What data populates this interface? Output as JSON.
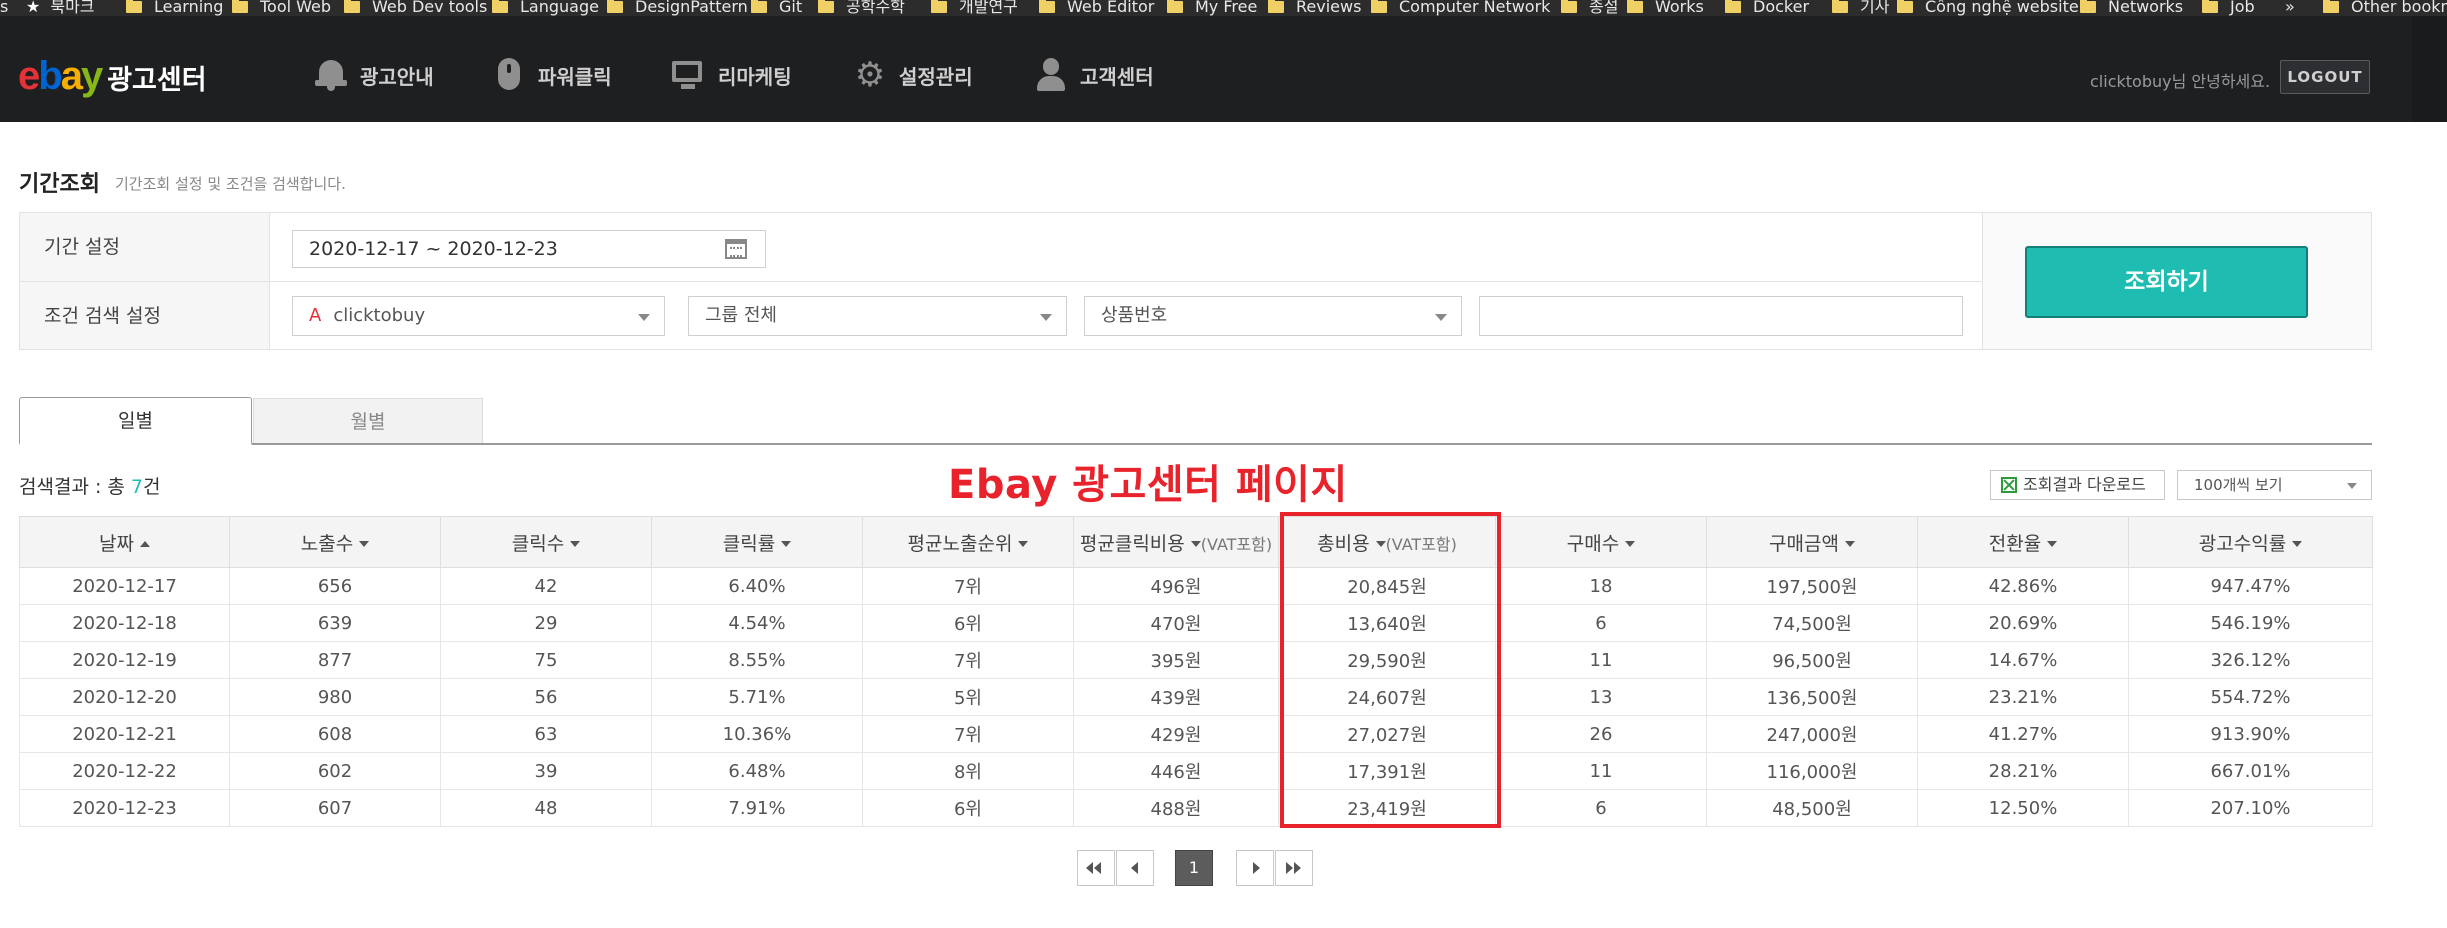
{
  "bookmarks": [
    {
      "label": "s",
      "icon": "none"
    },
    {
      "label": "북마크",
      "icon": "star-icon"
    },
    {
      "label": "Learning",
      "icon": "folder-icon"
    },
    {
      "label": "Tool Web",
      "icon": "folder-icon"
    },
    {
      "label": "Web Dev tools",
      "icon": "folder-icon"
    },
    {
      "label": "Language",
      "icon": "folder-icon"
    },
    {
      "label": "DesignPattern",
      "icon": "folder-icon"
    },
    {
      "label": "Git",
      "icon": "folder-icon"
    },
    {
      "label": "공학수학",
      "icon": "folder-icon"
    },
    {
      "label": "개발연구",
      "icon": "folder-icon"
    },
    {
      "label": "Web Editor",
      "icon": "folder-icon"
    },
    {
      "label": "My Free",
      "icon": "folder-icon"
    },
    {
      "label": "Reviews",
      "icon": "folder-icon"
    },
    {
      "label": "Computer Network",
      "icon": "folder-icon"
    },
    {
      "label": "종설",
      "icon": "folder-icon"
    },
    {
      "label": "Works",
      "icon": "folder-icon"
    },
    {
      "label": "Docker",
      "icon": "folder-icon"
    },
    {
      "label": "기사",
      "icon": "folder-icon"
    },
    {
      "label": "Công nghệ website",
      "icon": "folder-icon"
    },
    {
      "label": "Networks",
      "icon": "folder-icon"
    },
    {
      "label": "Job",
      "icon": "folder-icon"
    },
    {
      "label": "»",
      "icon": "none"
    },
    {
      "label": "Other bookmarks",
      "icon": "folder-icon"
    }
  ],
  "header": {
    "logo_text": "ebay",
    "logo_letters": [
      "e",
      "b",
      "a",
      "y"
    ],
    "title": "광고센터",
    "nav": [
      {
        "label": "광고안내",
        "icon": "bell-icon"
      },
      {
        "label": "파워클릭",
        "icon": "mouse-icon"
      },
      {
        "label": "리마케팅",
        "icon": "monitor-icon"
      },
      {
        "label": "설정관리",
        "icon": "gear-icon"
      },
      {
        "label": "고객센터",
        "icon": "user-icon"
      }
    ],
    "greeting": "clicktobuy님 안녕하세요.",
    "logout_label": "LOGOUT"
  },
  "search": {
    "title": "기간조회",
    "description": "기간조회 설정 및 조건을 검색합니다.",
    "period_label": "기간 설정",
    "date_range": "2020-12-17 ~ 2020-12-23",
    "condition_label": "조건 검색 설정",
    "account_prefix": "A",
    "account_select": "clicktobuy",
    "group_select": "그룹 전체",
    "product_select": "상품번호",
    "keyword_value": "",
    "query_button": "조회하기"
  },
  "tabs": [
    {
      "label": "일별",
      "active": true
    },
    {
      "label": "월별",
      "active": false
    }
  ],
  "results": {
    "count_prefix": "검색결과 : 총 ",
    "count": "7",
    "count_suffix": "건",
    "annotation": "Ebay 광고센터 페이지",
    "download_label": "조회결과 다운로드",
    "per_page": "100개씩 보기"
  },
  "table": {
    "columns": [
      {
        "label": "날짜",
        "sub": "",
        "sort": "up"
      },
      {
        "label": "노출수",
        "sub": "",
        "sort": "down"
      },
      {
        "label": "클릭수",
        "sub": "",
        "sort": "down"
      },
      {
        "label": "클릭률",
        "sub": "",
        "sort": "down"
      },
      {
        "label": "평균노출순위",
        "sub": "",
        "sort": "down"
      },
      {
        "label": "평균클릭비용",
        "sub": "(VAT포함)",
        "sort": "down"
      },
      {
        "label": "총비용",
        "sub": "(VAT포함)",
        "sort": "down"
      },
      {
        "label": "구매수",
        "sub": "",
        "sort": "down"
      },
      {
        "label": "구매금액",
        "sub": "",
        "sort": "down"
      },
      {
        "label": "전환율",
        "sub": "",
        "sort": "down"
      },
      {
        "label": "광고수익률",
        "sub": "",
        "sort": "down"
      }
    ],
    "rows": [
      [
        "2020-12-17",
        "656",
        "42",
        "6.40%",
        "7위",
        "496원",
        "20,845원",
        "18",
        "197,500원",
        "42.86%",
        "947.47%"
      ],
      [
        "2020-12-18",
        "639",
        "29",
        "4.54%",
        "6위",
        "470원",
        "13,640원",
        "6",
        "74,500원",
        "20.69%",
        "546.19%"
      ],
      [
        "2020-12-19",
        "877",
        "75",
        "8.55%",
        "7위",
        "395원",
        "29,590원",
        "11",
        "96,500원",
        "14.67%",
        "326.12%"
      ],
      [
        "2020-12-20",
        "980",
        "56",
        "5.71%",
        "5위",
        "439원",
        "24,607원",
        "13",
        "136,500원",
        "23.21%",
        "554.72%"
      ],
      [
        "2020-12-21",
        "608",
        "63",
        "10.36%",
        "7위",
        "429원",
        "27,027원",
        "26",
        "247,000원",
        "41.27%",
        "913.90%"
      ],
      [
        "2020-12-22",
        "602",
        "39",
        "6.48%",
        "8위",
        "446원",
        "17,391원",
        "11",
        "116,000원",
        "28.21%",
        "667.01%"
      ],
      [
        "2020-12-23",
        "607",
        "48",
        "7.91%",
        "6위",
        "488원",
        "23,419원",
        "6",
        "48,500원",
        "12.50%",
        "207.10%"
      ]
    ]
  },
  "pagination": {
    "current_page": "1",
    "first_icon": "first-page-icon",
    "prev_icon": "prev-page-icon",
    "next_icon": "next-page-icon",
    "last_icon": "last-page-icon"
  },
  "colors": {
    "accent": "#1fbdb1",
    "header_bg": "#1e1f21",
    "annotation_red": "#e8232b"
  }
}
